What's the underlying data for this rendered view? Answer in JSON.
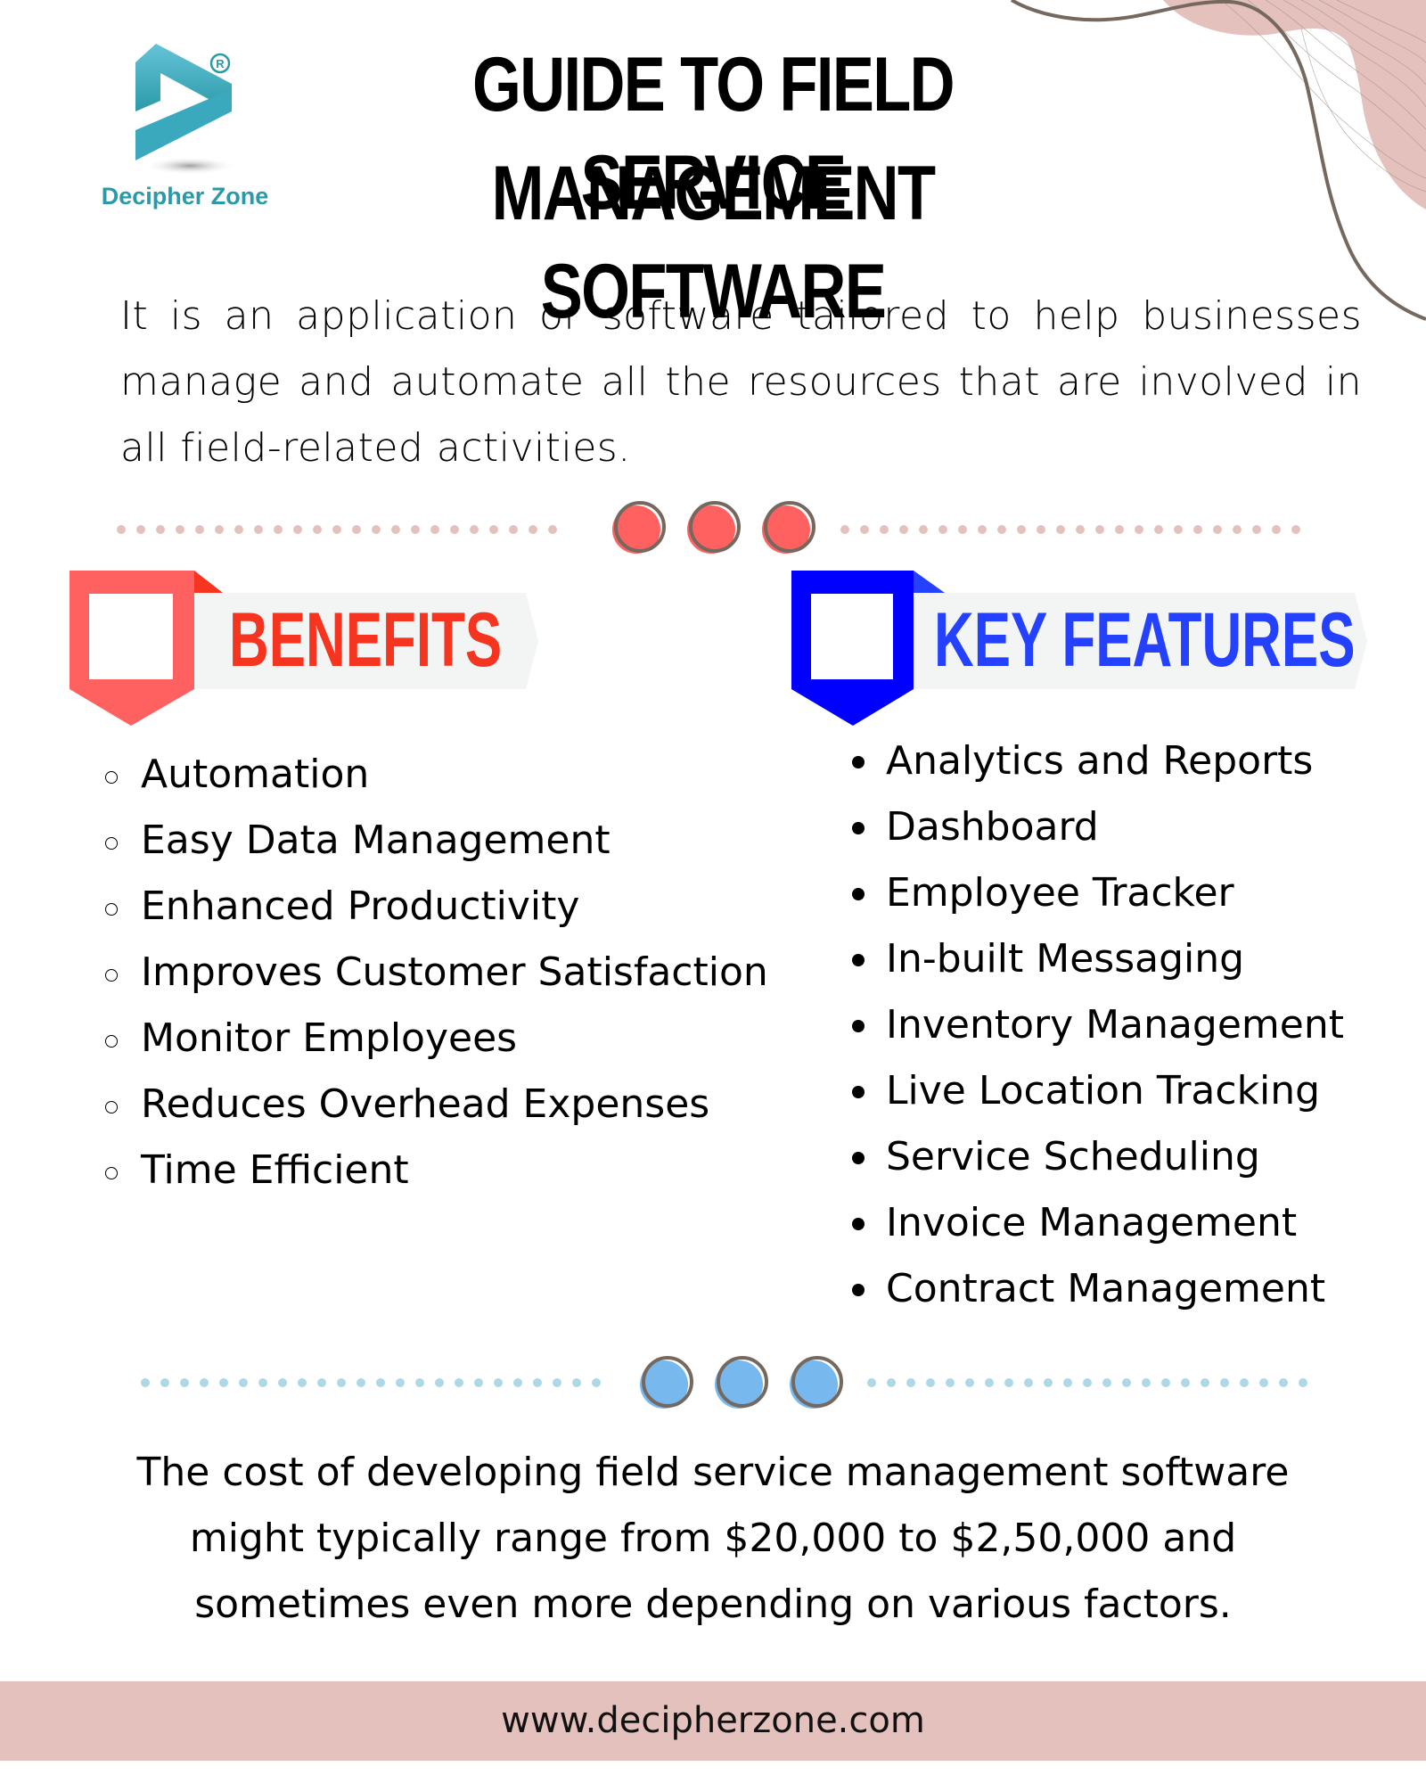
{
  "brand": {
    "name": "Decipher Zone",
    "registered_mark": "®",
    "logo_color": "#2a9aa8"
  },
  "header": {
    "title_line1": "GUIDE TO FIELD SERVICE",
    "title_line2": "MANAGEMENT SOFTWARE"
  },
  "intro": {
    "text": "It is an application or software tailored to help businesses manage and automate all the resources that are involved in all field-related activities."
  },
  "benefits": {
    "title": "BENEFITS",
    "accent_color": "#ff6161",
    "title_color": "#f53520",
    "bullet_icon": "hollow-circle",
    "items": [
      "Automation",
      "Easy Data Management",
      "Enhanced Productivity",
      "Improves Customer Satisfaction",
      "Monitor Employees",
      "Reduces Overhead Expenses",
      "Time Efficient"
    ]
  },
  "features": {
    "title": "KEY FEATURES",
    "accent_color": "#0000ff",
    "title_color": "#2441ff",
    "bullet_icon": "filled-circle",
    "items": [
      "Analytics and Reports",
      "Dashboard",
      "Employee Tracker",
      "In-built Messaging",
      "Inventory Management",
      "Live Location Tracking",
      "Service Scheduling",
      "Invoice Management",
      "Contract Management"
    ]
  },
  "cost": {
    "line1": "The cost of developing field service management software",
    "line2": "might typically range from $20,000 to $2,50,000 and",
    "line3": "sometimes even more depending on various factors."
  },
  "footer": {
    "url": "www.decipherzone.com",
    "background": "#e5c1bd"
  },
  "colors": {
    "divider_top_dots": "#e5c1bd",
    "divider_top_circles": "#ff6161",
    "divider_bottom_dots": "#add8e6",
    "divider_bottom_circles": "#77b8ee",
    "circle_outline": "#75685e",
    "banner_bar": "#f3f5f5",
    "blob": "#e5c1bd",
    "curve": "#75685e"
  }
}
